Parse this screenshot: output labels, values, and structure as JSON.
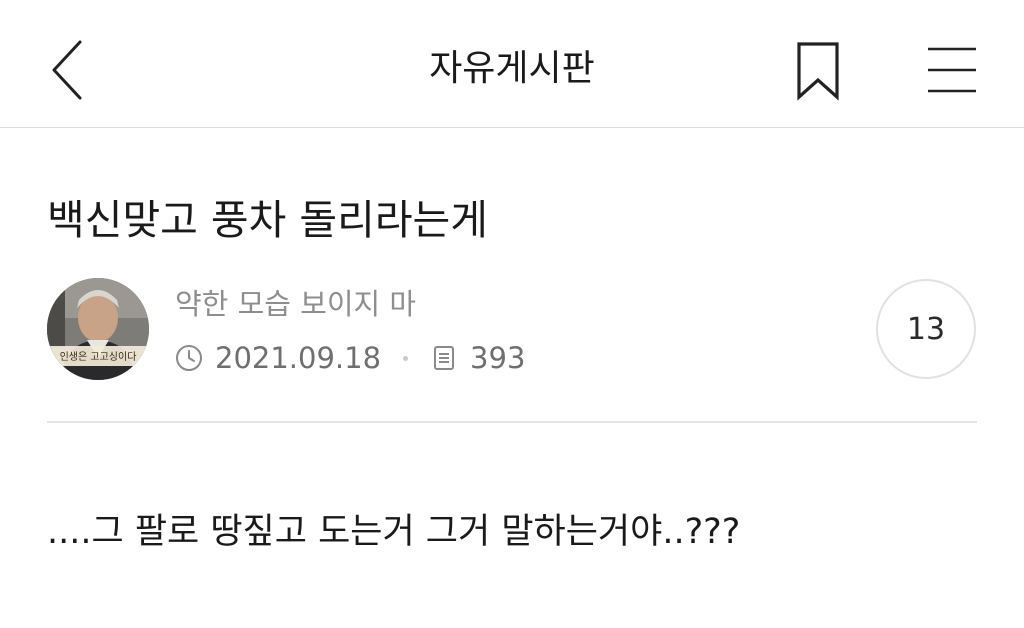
{
  "header": {
    "title": "자유게시판",
    "back_icon": "chevron-left-icon",
    "bookmark_icon": "bookmark-icon",
    "menu_icon": "hamburger-menu-icon"
  },
  "post": {
    "title": "백신맞고 풍차 돌리라는게",
    "author": {
      "name": "약한 모습 보이지 마",
      "avatar_caption": "인생은 고고싱이다"
    },
    "date": "2021.09.18",
    "views": "393",
    "comment_count": "13",
    "body": "....그 팔로 땅짚고 도는거 그거 말하는거야..???"
  },
  "colors": {
    "text_primary": "#1a1a1a",
    "text_secondary": "#8e8e8e",
    "divider": "#e5e5e5",
    "badge_border": "#e1e1e1"
  }
}
